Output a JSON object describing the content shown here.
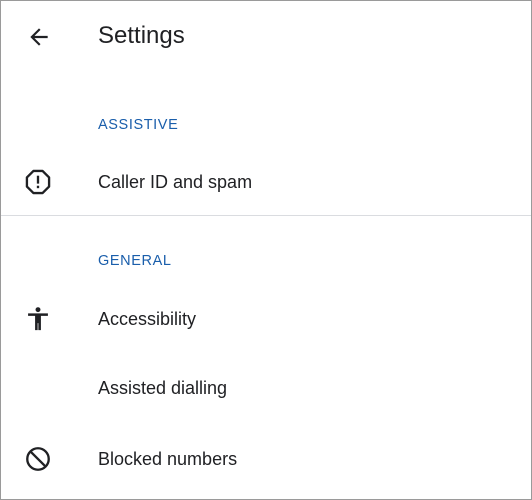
{
  "header": {
    "back_icon": "arrow-back-icon",
    "title": "Settings"
  },
  "sections": [
    {
      "header": "ASSISTIVE",
      "items": [
        {
          "label": "Caller ID and spam",
          "icon": "report-octagon-icon"
        }
      ]
    },
    {
      "header": "GENERAL",
      "items": [
        {
          "label": "Accessibility",
          "icon": "accessibility-icon"
        },
        {
          "label": "Assisted dialling",
          "icon": ""
        },
        {
          "label": "Blocked numbers",
          "icon": "block-icon"
        }
      ]
    }
  ],
  "colors": {
    "section_header": "#1a5eab",
    "text": "#202124",
    "divider": "#dadce0"
  }
}
